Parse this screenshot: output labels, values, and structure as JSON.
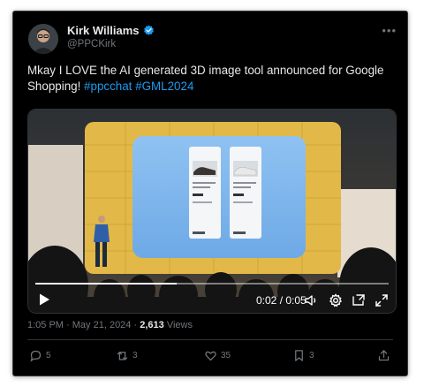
{
  "author": {
    "display_name": "Kirk Williams",
    "handle": "@PPCKirk"
  },
  "icons": {
    "verified": "verified-badge-icon",
    "more": "more-options-icon"
  },
  "tweet": {
    "text": "Mkay I LOVE the AI generated 3D image tool announced for Google Shopping!",
    "hashtags": [
      "#ppcchat",
      "#GML2024"
    ]
  },
  "video": {
    "time_display": "0:02 / 0:05",
    "progress": 0.4
  },
  "meta": {
    "time": "1:05 PM",
    "separator": "·",
    "date": "May 21, 2024",
    "views_count": "2,613",
    "views_label": "Views"
  },
  "actions": {
    "replies": "5",
    "reposts": "3",
    "likes": "35",
    "bookmarks": "3"
  },
  "colors": {
    "background": "#000000",
    "text": "#e7e9ea",
    "muted": "#71767b",
    "accent": "#1d9bf0"
  }
}
